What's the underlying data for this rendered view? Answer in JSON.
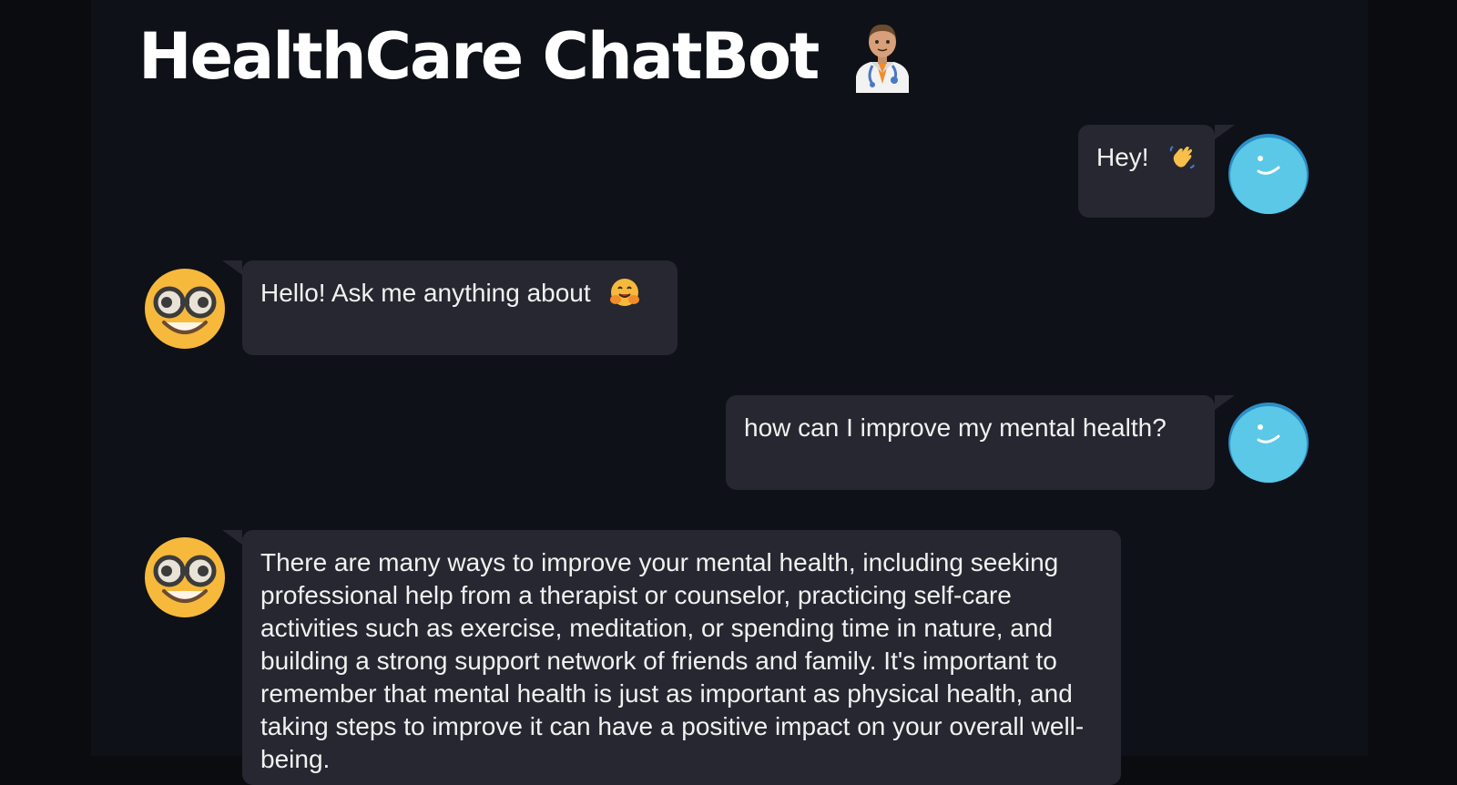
{
  "app": {
    "title": "HealthCare ChatBot",
    "title_icon": "doctor-emoji",
    "colors": {
      "page_background": "#0e1117",
      "outer_background": "#0b0c0f",
      "bubble_background": "#262730",
      "user_avatar": "#5ac8e6",
      "bot_avatar": "#f6b93b"
    }
  },
  "messages": [
    {
      "role": "user",
      "text": "Hey!",
      "emoji_icon": "waving-hand-emoji",
      "avatar_icon": "smiley-avatar-icon"
    },
    {
      "role": "bot",
      "text": "Hello! Ask me anything about",
      "emoji_icon": "hugging-face-emoji",
      "avatar_icon": "nerd-face-avatar-icon"
    },
    {
      "role": "user",
      "text": "how can I improve my mental health?",
      "avatar_icon": "smiley-avatar-icon"
    },
    {
      "role": "bot",
      "text": "There are many ways to improve your mental health, including seeking professional help from a therapist or counselor, practicing self-care activities such as exercise, meditation, or spending time in nature, and building a strong support network of friends and family. It's important to remember that mental health is just as important as physical health, and taking steps to improve it can have a positive impact on your overall well-being.",
      "avatar_icon": "nerd-face-avatar-icon"
    }
  ]
}
